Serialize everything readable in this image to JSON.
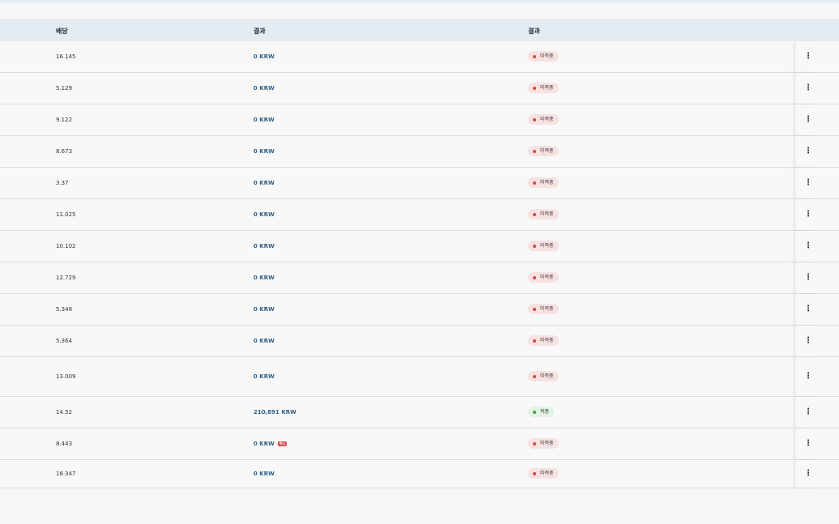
{
  "table": {
    "headers": {
      "odds": "배당",
      "result_amount": "결과",
      "result_status": "결과"
    },
    "rows": [
      {
        "odds": "16.145",
        "amount": "0 KRW",
        "status": "미적중",
        "status_type": "lose"
      },
      {
        "odds": "5.129",
        "amount": "0 KRW",
        "status": "미적중",
        "status_type": "lose"
      },
      {
        "odds": "9.122",
        "amount": "0 KRW",
        "status": "미적중",
        "status_type": "lose"
      },
      {
        "odds": "8.673",
        "amount": "0 KRW",
        "status": "미적중",
        "status_type": "lose"
      },
      {
        "odds": "3.37",
        "amount": "0 KRW",
        "status": "미적중",
        "status_type": "lose"
      },
      {
        "odds": "11.025",
        "amount": "0 KRW",
        "status": "미적중",
        "status_type": "lose"
      },
      {
        "odds": "10.102",
        "amount": "0 KRW",
        "status": "미적중",
        "status_type": "lose"
      },
      {
        "odds": "12.729",
        "amount": "0 KRW",
        "status": "미적중",
        "status_type": "lose"
      },
      {
        "odds": "5.348",
        "amount": "0 KRW",
        "status": "미적중",
        "status_type": "lose"
      },
      {
        "odds": "5.364",
        "amount": "0 KRW",
        "status": "미적중",
        "status_type": "lose"
      },
      {
        "odds": "13.009",
        "amount": "0 KRW",
        "status": "미적중",
        "status_type": "lose"
      },
      {
        "odds": "14.52",
        "amount": "210,891 KRW",
        "status": "적중",
        "status_type": "win"
      },
      {
        "odds": "8.443",
        "amount": "0 KRW",
        "status": "미적중",
        "status_type": "lose",
        "tag": "취소"
      },
      {
        "odds": "16.347",
        "amount": "0 KRW",
        "status": "미적중",
        "status_type": "lose"
      }
    ],
    "menu_icon": "more-vertical-icon"
  },
  "colors": {
    "header_bg": "#e3ebf3",
    "amount_text": "#2f5d86",
    "lose_dot": "#e04343",
    "lose_bg": "#f7e1e1",
    "win_dot": "#36a84a",
    "win_bg": "#e2f3e4"
  }
}
